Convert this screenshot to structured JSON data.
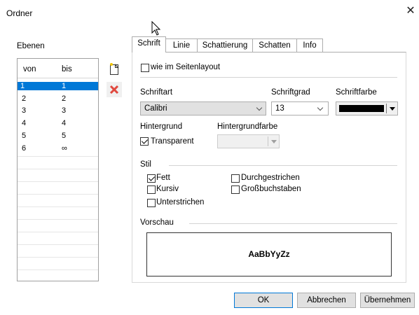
{
  "window": {
    "title": "Ordner",
    "close_glyph": "✕"
  },
  "layers": {
    "label": "Ebenen",
    "columns": [
      "von",
      "bis"
    ],
    "rows": [
      {
        "von": "1",
        "bis": "1",
        "selected": true
      },
      {
        "von": "2",
        "bis": "2"
      },
      {
        "von": "3",
        "bis": "3"
      },
      {
        "von": "4",
        "bis": "4"
      },
      {
        "von": "5",
        "bis": "5"
      },
      {
        "von": "6",
        "bis": "∞"
      }
    ],
    "add_icon": "new-document-icon",
    "delete_icon": "red-x-icon"
  },
  "tabs": [
    {
      "label": "Schrift",
      "active": true
    },
    {
      "label": "Linie"
    },
    {
      "label": "Schattierung"
    },
    {
      "label": "Schatten"
    },
    {
      "label": "Info"
    }
  ],
  "font_tab": {
    "page_layout_label": "wie im Seitenlayout",
    "font_label": "Schriftart",
    "font_value": "Calibri",
    "size_label": "Schriftgrad",
    "size_value": "13",
    "color_label": "Schriftfarbe",
    "color_value": "#000000",
    "background_label": "Hintergrund",
    "transparent_label": "Transparent",
    "bg_color_label": "Hintergrundfarbe",
    "style_label": "Stil",
    "bold_label": "Fett",
    "italic_label": "Kursiv",
    "underline_label": "Unterstrichen",
    "strike_label": "Durchgestrichen",
    "caps_label": "Großbuchstaben",
    "preview_label": "Vorschau",
    "preview_text": "AaBbYyZz"
  },
  "buttons": {
    "ok": "OK",
    "cancel": "Abbrechen",
    "apply": "Übernehmen"
  },
  "colors": {
    "selection": "#0078d7",
    "button_face": "#e1e1e1",
    "border": "#adadad"
  }
}
